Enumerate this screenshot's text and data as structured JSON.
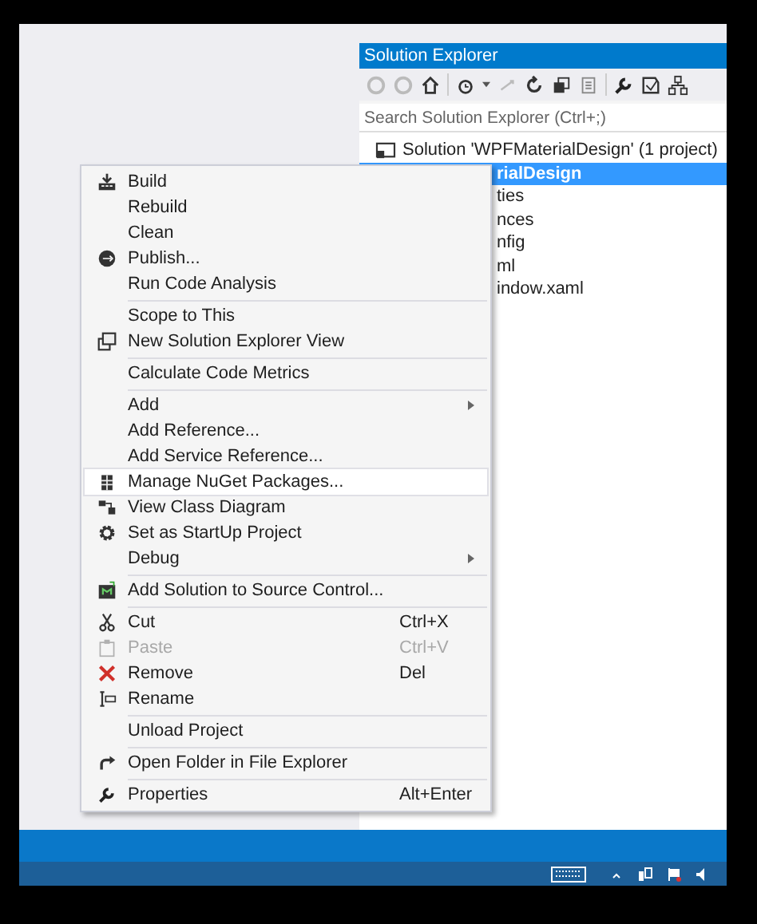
{
  "solution_explorer": {
    "title": "Solution Explorer",
    "search": {
      "placeholder": "Search Solution Explorer (Ctrl+;)"
    },
    "tree": [
      {
        "label": "Solution 'WPFMaterialDesign' (1 project)",
        "selected": false,
        "children": [
          {
            "label": "rialDesign",
            "selected": true,
            "children": [
              {
                "label": "ties",
                "selected": false
              },
              {
                "label": "nces",
                "selected": false
              },
              {
                "label": "nfig",
                "selected": false
              },
              {
                "label": "ml",
                "selected": false
              },
              {
                "label": "indow.xaml",
                "selected": false
              }
            ]
          }
        ]
      }
    ]
  },
  "context_menu": {
    "items": [
      {
        "kind": "item",
        "label": "Build",
        "selected": false
      },
      {
        "kind": "item",
        "label": "Rebuild",
        "selected": false
      },
      {
        "kind": "item",
        "label": "Clean",
        "selected": false
      },
      {
        "kind": "item",
        "label": "Publish...",
        "selected": false
      },
      {
        "kind": "item",
        "label": "Run Code Analysis",
        "selected": false
      },
      {
        "kind": "separator"
      },
      {
        "kind": "item",
        "label": "Scope to This",
        "selected": false
      },
      {
        "kind": "item",
        "label": "New Solution Explorer View",
        "selected": false
      },
      {
        "kind": "separator"
      },
      {
        "kind": "item",
        "label": "Calculate Code Metrics",
        "selected": false
      },
      {
        "kind": "separator"
      },
      {
        "kind": "item",
        "label": "Add",
        "selected": false,
        "submenu": true
      },
      {
        "kind": "item",
        "label": "Add Reference...",
        "selected": false
      },
      {
        "kind": "item",
        "label": "Add Service Reference...",
        "selected": false
      },
      {
        "kind": "item",
        "label": "Manage NuGet Packages...",
        "selected": true
      },
      {
        "kind": "item",
        "label": "View Class Diagram",
        "selected": false
      },
      {
        "kind": "item",
        "label": "Set as StartUp Project",
        "selected": false
      },
      {
        "kind": "item",
        "label": "Debug",
        "selected": false,
        "submenu": true
      },
      {
        "kind": "separator"
      },
      {
        "kind": "item",
        "label": "Add Solution to Source Control...",
        "selected": false
      },
      {
        "kind": "separator"
      },
      {
        "kind": "item",
        "label": "Cut",
        "shortcut": "Ctrl+X",
        "selected": false,
        "disabled": false
      },
      {
        "kind": "item",
        "label": "Paste",
        "shortcut": "Ctrl+V",
        "selected": false,
        "disabled": true
      },
      {
        "kind": "item",
        "label": "Remove",
        "shortcut": "Del",
        "selected": false,
        "disabled": false
      },
      {
        "kind": "item",
        "label": "Rename",
        "selected": false
      },
      {
        "kind": "separator"
      },
      {
        "kind": "item",
        "label": "Unload Project",
        "selected": false
      },
      {
        "kind": "separator"
      },
      {
        "kind": "item",
        "label": "Open Folder in File Explorer",
        "selected": false
      },
      {
        "kind": "separator"
      },
      {
        "kind": "item",
        "label": "Properties",
        "shortcut": "Alt+Enter",
        "selected": false
      }
    ]
  }
}
